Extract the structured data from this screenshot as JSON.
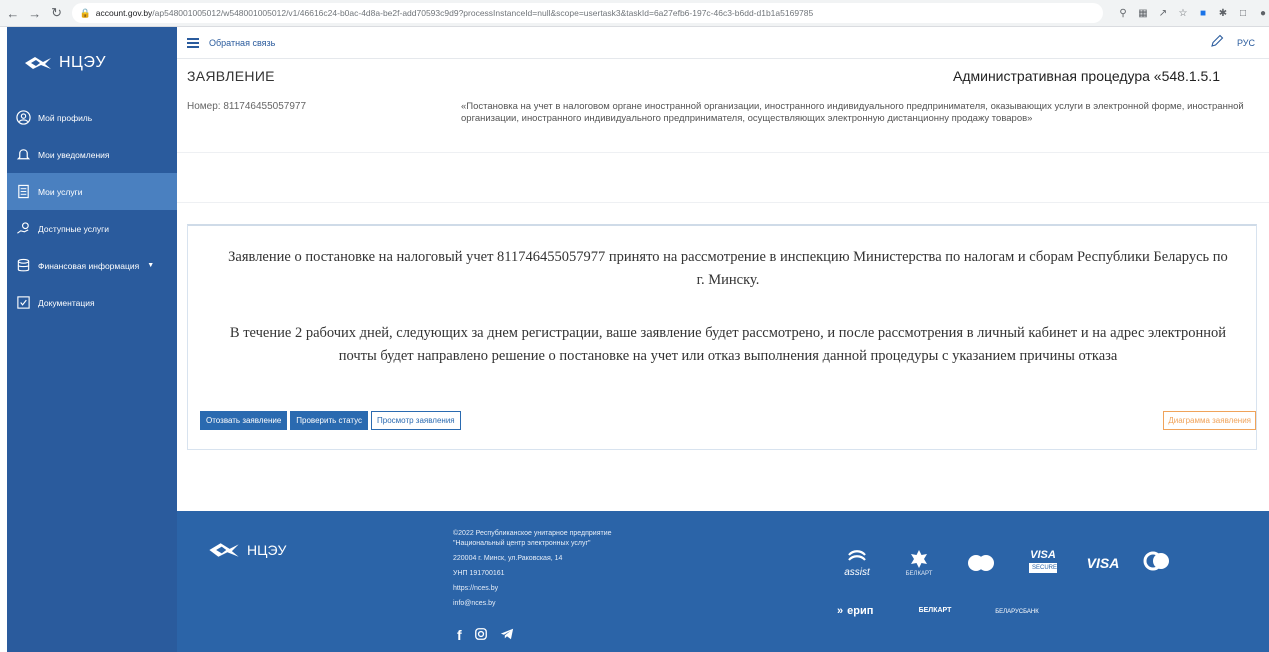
{
  "browser": {
    "url_host": "account.gov.by",
    "url_path": "/ap548001005012/w548001005012/v1/46616c24-b0ac-4d8a-be2f-add70593c9d9?processInstanceId=null&scope=usertask3&taskId=6a27efb6-197c-46c3-b6dd-d1b1a5169785"
  },
  "sidebar": {
    "logo_text": "НЦЭУ",
    "items": [
      {
        "label": "Мой профиль"
      },
      {
        "label": "Мои уведомления"
      },
      {
        "label": "Мои услуги"
      },
      {
        "label": "Доступные услуги"
      },
      {
        "label": "Финансовая информация"
      },
      {
        "label": "Документация"
      }
    ],
    "active_index": 2
  },
  "topbar": {
    "feedback_label": "Обратная связь",
    "lang_label": "РУС"
  },
  "page": {
    "title": "ЗАЯВЛЕНИЕ",
    "procedure_title": "Административная процедура «548.1.5.1",
    "order_number": "Номер: 811746455057977",
    "procedure_description": "«Постановка на учет в налоговом органе иностранной организации, иностранного индивидуального предпринимателя, оказывающих услуги в электронной форме, иностранной организации, иностранного индивидуального предпринимателя, осуществляющих электронную дистанционну продажу товаров»"
  },
  "card": {
    "message1": "Заявление о постановке на налоговый учет 811746455057977 принято на рассмотрение в инспекцию Министерства по налогам и сборам Республики Беларусь по г. Минску.",
    "message2": "В течение 2 рабочих дней, следующих за днем регистрации, ваше заявление будет рассмотрено, и после рассмотрения в личный кабинет и на адрес электронной почты будет направлено решение о постановке на учет или отказ выполнения данной процедуры с указанием причины отказа",
    "buttons": {
      "withdraw": "Отозвать заявление",
      "check_status": "Проверить статус",
      "view": "Просмотр заявления",
      "diagram": "Диаграмма заявления"
    }
  },
  "footer": {
    "logo_text": "НЦЭУ",
    "copyright_line1": "©2022 Республиканское унитарное предприятие",
    "copyright_line2": "\"Национальный центр электронных услуг\"",
    "address": "220004 г. Минск, ул.Раковская, 14",
    "unp": "УНП 191700161",
    "site": "https://nces.by",
    "email": "info@nces.by",
    "payment": {
      "assist": "assist",
      "belkart": "БЕЛКАРТ",
      "visa": "VISA",
      "visa_secure": "SECURE",
      "erip": "ерип",
      "belkart2": "БЕЛКАРТ",
      "bank": "БЕЛАРУСБАНК"
    }
  },
  "colors": {
    "sidebar_bg": "#2a5b9d",
    "sidebar_active": "#4a80c0",
    "footer_bg": "#2b64a8",
    "primary_button": "#2a6ab0",
    "diagram_button": "#f0a35a"
  }
}
